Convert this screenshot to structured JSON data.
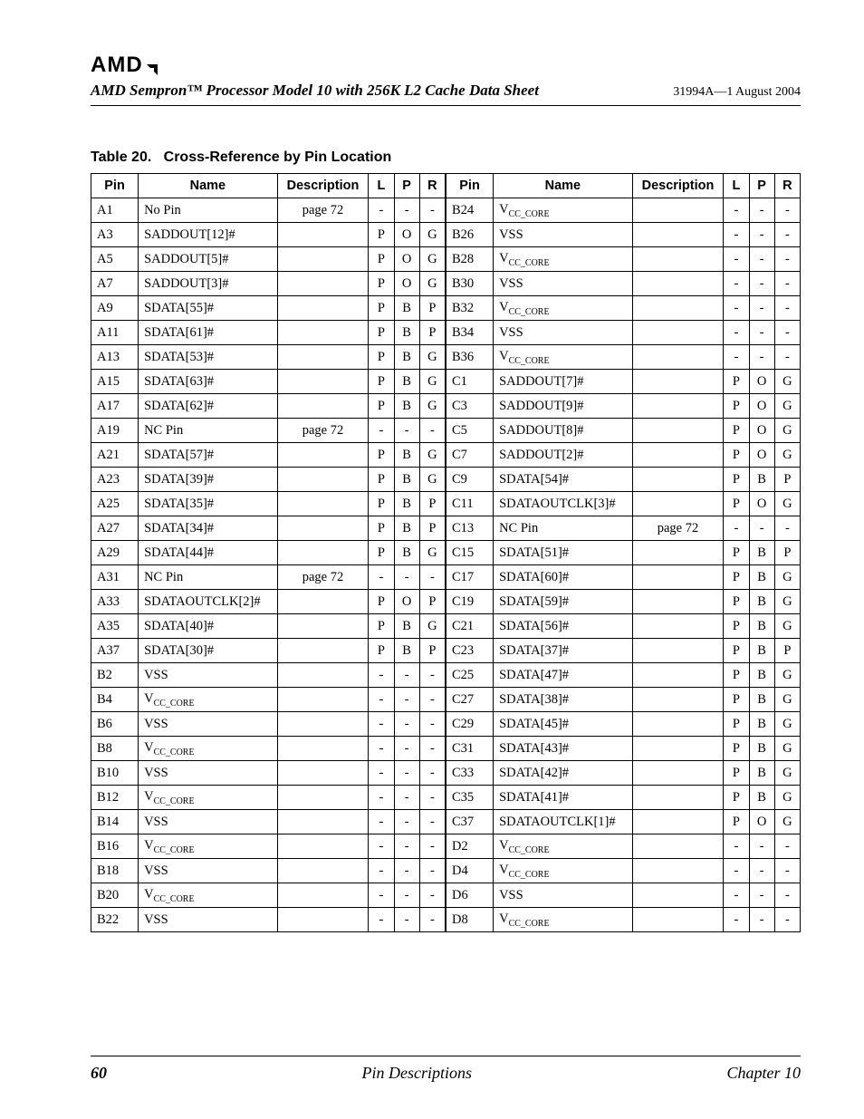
{
  "header": {
    "logo_text": "AMD",
    "doc_title": "AMD Sempron™ Processor Model 10 with 256K L2 Cache Data Sheet",
    "doc_id": "31994A—1 August 2004"
  },
  "table": {
    "caption_label": "Table 20.",
    "caption_title": "Cross-Reference by Pin Location",
    "headers": {
      "pin": "Pin",
      "name": "Name",
      "desc": "Description",
      "l": "L",
      "p": "P",
      "r": "R"
    },
    "left_rows": [
      {
        "pin": "A1",
        "name": "No Pin",
        "desc": "page 72",
        "l": "-",
        "p": "-",
        "r": "-"
      },
      {
        "pin": "A3",
        "name": "SADDOUT[12]#",
        "desc": "",
        "l": "P",
        "p": "O",
        "r": "G"
      },
      {
        "pin": "A5",
        "name": "SADDOUT[5]#",
        "desc": "",
        "l": "P",
        "p": "O",
        "r": "G"
      },
      {
        "pin": "A7",
        "name": "SADDOUT[3]#",
        "desc": "",
        "l": "P",
        "p": "O",
        "r": "G"
      },
      {
        "pin": "A9",
        "name": "SDATA[55]#",
        "desc": "",
        "l": "P",
        "p": "B",
        "r": "P"
      },
      {
        "pin": "A11",
        "name": "SDATA[61]#",
        "desc": "",
        "l": "P",
        "p": "B",
        "r": "P"
      },
      {
        "pin": "A13",
        "name": "SDATA[53]#",
        "desc": "",
        "l": "P",
        "p": "B",
        "r": "G"
      },
      {
        "pin": "A15",
        "name": "SDATA[63]#",
        "desc": "",
        "l": "P",
        "p": "B",
        "r": "G"
      },
      {
        "pin": "A17",
        "name": "SDATA[62]#",
        "desc": "",
        "l": "P",
        "p": "B",
        "r": "G"
      },
      {
        "pin": "A19",
        "name": "NC Pin",
        "desc": "page 72",
        "l": "-",
        "p": "-",
        "r": "-"
      },
      {
        "pin": "A21",
        "name": "SDATA[57]#",
        "desc": "",
        "l": "P",
        "p": "B",
        "r": "G"
      },
      {
        "pin": "A23",
        "name": "SDATA[39]#",
        "desc": "",
        "l": "P",
        "p": "B",
        "r": "G"
      },
      {
        "pin": "A25",
        "name": "SDATA[35]#",
        "desc": "",
        "l": "P",
        "p": "B",
        "r": "P"
      },
      {
        "pin": "A27",
        "name": "SDATA[34]#",
        "desc": "",
        "l": "P",
        "p": "B",
        "r": "P"
      },
      {
        "pin": "A29",
        "name": "SDATA[44]#",
        "desc": "",
        "l": "P",
        "p": "B",
        "r": "G"
      },
      {
        "pin": "A31",
        "name": "NC Pin",
        "desc": "page 72",
        "l": "-",
        "p": "-",
        "r": "-"
      },
      {
        "pin": "A33",
        "name": "SDATAOUTCLK[2]#",
        "desc": "",
        "l": "P",
        "p": "O",
        "r": "P"
      },
      {
        "pin": "A35",
        "name": "SDATA[40]#",
        "desc": "",
        "l": "P",
        "p": "B",
        "r": "G"
      },
      {
        "pin": "A37",
        "name": "SDATA[30]#",
        "desc": "",
        "l": "P",
        "p": "B",
        "r": "P"
      },
      {
        "pin": "B2",
        "name": "VSS",
        "desc": "",
        "l": "-",
        "p": "-",
        "r": "-"
      },
      {
        "pin": "B4",
        "name_html": "V<span class=\"sub\">CC_CORE</span>",
        "desc": "",
        "l": "-",
        "p": "-",
        "r": "-"
      },
      {
        "pin": "B6",
        "name": "VSS",
        "desc": "",
        "l": "-",
        "p": "-",
        "r": "-"
      },
      {
        "pin": "B8",
        "name_html": "V<span class=\"sub\">CC_CORE</span>",
        "desc": "",
        "l": "-",
        "p": "-",
        "r": "-"
      },
      {
        "pin": "B10",
        "name": "VSS",
        "desc": "",
        "l": "-",
        "p": "-",
        "r": "-"
      },
      {
        "pin": "B12",
        "name_html": "V<span class=\"sub\">CC_CORE</span>",
        "desc": "",
        "l": "-",
        "p": "-",
        "r": "-"
      },
      {
        "pin": "B14",
        "name": "VSS",
        "desc": "",
        "l": "-",
        "p": "-",
        "r": "-"
      },
      {
        "pin": "B16",
        "name_html": "V<span class=\"sub\">CC_CORE</span>",
        "desc": "",
        "l": "-",
        "p": "-",
        "r": "-"
      },
      {
        "pin": "B18",
        "name": "VSS",
        "desc": "",
        "l": "-",
        "p": "-",
        "r": "-"
      },
      {
        "pin": "B20",
        "name_html": "V<span class=\"sub\">CC_CORE</span>",
        "desc": "",
        "l": "-",
        "p": "-",
        "r": "-"
      },
      {
        "pin": "B22",
        "name": "VSS",
        "desc": "",
        "l": "-",
        "p": "-",
        "r": "-"
      }
    ],
    "right_rows": [
      {
        "pin": "B24",
        "name_html": "V<span class=\"sub\">CC_CORE</span>",
        "desc": "",
        "l": "-",
        "p": "-",
        "r": "-"
      },
      {
        "pin": "B26",
        "name": "VSS",
        "desc": "",
        "l": "-",
        "p": "-",
        "r": "-"
      },
      {
        "pin": "B28",
        "name_html": "V<span class=\"sub\">CC_CORE</span>",
        "desc": "",
        "l": "-",
        "p": "-",
        "r": "-"
      },
      {
        "pin": "B30",
        "name": "VSS",
        "desc": "",
        "l": "-",
        "p": "-",
        "r": "-"
      },
      {
        "pin": "B32",
        "name_html": "V<span class=\"sub\">CC_CORE</span>",
        "desc": "",
        "l": "-",
        "p": "-",
        "r": "-"
      },
      {
        "pin": "B34",
        "name": "VSS",
        "desc": "",
        "l": "-",
        "p": "-",
        "r": "-"
      },
      {
        "pin": "B36",
        "name_html": "V<span class=\"sub\">CC_CORE</span>",
        "desc": "",
        "l": "-",
        "p": "-",
        "r": "-"
      },
      {
        "pin": "C1",
        "name": "SADDOUT[7]#",
        "desc": "",
        "l": "P",
        "p": "O",
        "r": "G"
      },
      {
        "pin": "C3",
        "name": "SADDOUT[9]#",
        "desc": "",
        "l": "P",
        "p": "O",
        "r": "G"
      },
      {
        "pin": "C5",
        "name": "SADDOUT[8]#",
        "desc": "",
        "l": "P",
        "p": "O",
        "r": "G"
      },
      {
        "pin": "C7",
        "name": "SADDOUT[2]#",
        "desc": "",
        "l": "P",
        "p": "O",
        "r": "G"
      },
      {
        "pin": "C9",
        "name": "SDATA[54]#",
        "desc": "",
        "l": "P",
        "p": "B",
        "r": "P"
      },
      {
        "pin": "C11",
        "name": "SDATAOUTCLK[3]#",
        "desc": "",
        "l": "P",
        "p": "O",
        "r": "G"
      },
      {
        "pin": "C13",
        "name": "NC Pin",
        "desc": "page 72",
        "l": "-",
        "p": "-",
        "r": "-"
      },
      {
        "pin": "C15",
        "name": "SDATA[51]#",
        "desc": "",
        "l": "P",
        "p": "B",
        "r": "P"
      },
      {
        "pin": "C17",
        "name": "SDATA[60]#",
        "desc": "",
        "l": "P",
        "p": "B",
        "r": "G"
      },
      {
        "pin": "C19",
        "name": "SDATA[59]#",
        "desc": "",
        "l": "P",
        "p": "B",
        "r": "G"
      },
      {
        "pin": "C21",
        "name": "SDATA[56]#",
        "desc": "",
        "l": "P",
        "p": "B",
        "r": "G"
      },
      {
        "pin": "C23",
        "name": "SDATA[37]#",
        "desc": "",
        "l": "P",
        "p": "B",
        "r": "P"
      },
      {
        "pin": "C25",
        "name": "SDATA[47]#",
        "desc": "",
        "l": "P",
        "p": "B",
        "r": "G"
      },
      {
        "pin": "C27",
        "name": "SDATA[38]#",
        "desc": "",
        "l": "P",
        "p": "B",
        "r": "G"
      },
      {
        "pin": "C29",
        "name": "SDATA[45]#",
        "desc": "",
        "l": "P",
        "p": "B",
        "r": "G"
      },
      {
        "pin": "C31",
        "name": "SDATA[43]#",
        "desc": "",
        "l": "P",
        "p": "B",
        "r": "G"
      },
      {
        "pin": "C33",
        "name": "SDATA[42]#",
        "desc": "",
        "l": "P",
        "p": "B",
        "r": "G"
      },
      {
        "pin": "C35",
        "name": "SDATA[41]#",
        "desc": "",
        "l": "P",
        "p": "B",
        "r": "G"
      },
      {
        "pin": "C37",
        "name": "SDATAOUTCLK[1]#",
        "desc": "",
        "l": "P",
        "p": "O",
        "r": "G"
      },
      {
        "pin": "D2",
        "name_html": "V<span class=\"sub\">CC_CORE</span>",
        "desc": "",
        "l": "-",
        "p": "-",
        "r": "-"
      },
      {
        "pin": "D4",
        "name_html": "V<span class=\"sub\">CC_CORE</span>",
        "desc": "",
        "l": "-",
        "p": "-",
        "r": "-"
      },
      {
        "pin": "D6",
        "name": "VSS",
        "desc": "",
        "l": "-",
        "p": "-",
        "r": "-"
      },
      {
        "pin": "D8",
        "name_html": "V<span class=\"sub\">CC_CORE</span>",
        "desc": "",
        "l": "-",
        "p": "-",
        "r": "-"
      }
    ]
  },
  "footer": {
    "page_number": "60",
    "section": "Pin Descriptions",
    "chapter": "Chapter 10"
  }
}
